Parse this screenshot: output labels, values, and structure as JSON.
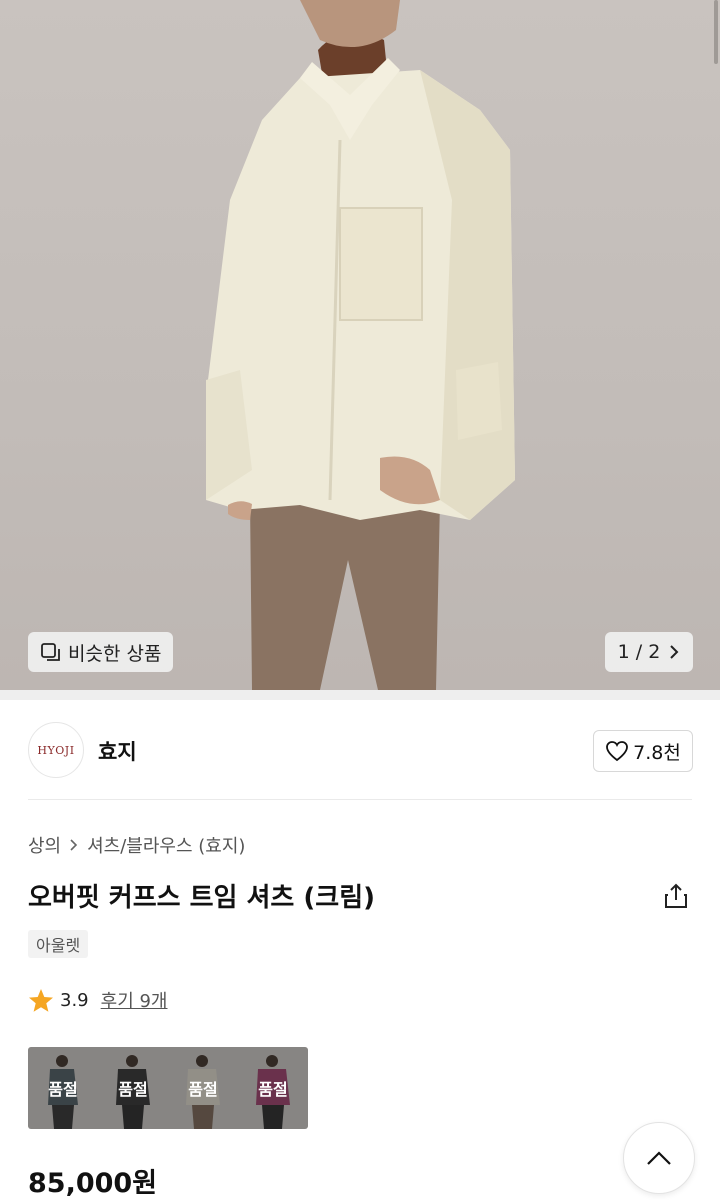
{
  "hero": {
    "similar_label": "비슷한 상품",
    "page_indicator": "1 / 2"
  },
  "brand": {
    "logo_text": "HYOJI",
    "name": "효지",
    "likes": "7.8천"
  },
  "product": {
    "breadcrumb": [
      "상의",
      "셔츠/블라우스 (효지)"
    ],
    "title": "오버핏 커프스 트임 셔츠 (크림)",
    "badge": "아울렛",
    "rating": "3.9",
    "reviews": "후기 9개",
    "price": "85,000원"
  },
  "options": [
    {
      "status": "품절",
      "color": "#4a5a62"
    },
    {
      "status": "품절",
      "color": "#2b2b2b"
    },
    {
      "status": "품절",
      "color": "#e9e4d6"
    },
    {
      "status": "품절",
      "color": "#a03a6a"
    }
  ],
  "colors": {
    "star": "#f5a623",
    "background": "#ffffff"
  }
}
